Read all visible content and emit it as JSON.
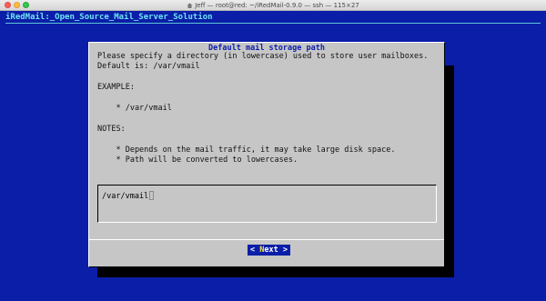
{
  "window": {
    "title": "Jeff — root@red: ~/iRedMail-0.9.0 — ssh — 115×27"
  },
  "terminal": {
    "backtitle": "iRedMail:_Open_Source_Mail_Server_Solution"
  },
  "dialog": {
    "title": "Default mail storage path",
    "lines": [
      "Please specify a directory (in lowercase) used to store user mailboxes.",
      "Default is: /var/vmail",
      "EXAMPLE:",
      "    * /var/vmail",
      "NOTES:",
      "    * Depends on the mail traffic, it may take large disk space.",
      "    * Path will be converted to lowercases."
    ],
    "input_value": "/var/vmail",
    "button": {
      "open": "<",
      "hotkey": " N",
      "rest": "ext ",
      "close": ">"
    }
  },
  "colors": {
    "terminal_bg": "#0b1ea8",
    "dialog_bg": "#c6c6c6",
    "backtitle": "#6fe3f2",
    "hotkey": "#f2e24a"
  }
}
